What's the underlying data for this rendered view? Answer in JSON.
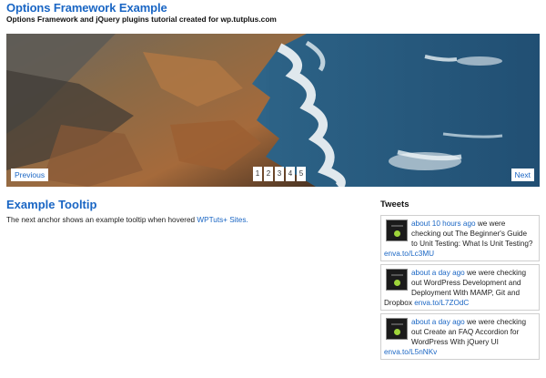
{
  "site": {
    "title": "Options Framework Example",
    "description": "Options Framework and jQuery plugins tutorial created for wp.tutplus.com"
  },
  "slider": {
    "prev_label": "Previous",
    "next_label": "Next",
    "pages": [
      "1",
      "2",
      "3",
      "4",
      "5"
    ]
  },
  "main": {
    "title": "Example Tooltip",
    "text": "The next anchor shows an example tooltip when hovered",
    "link": "WPTuts+ Sites."
  },
  "sidebar": {
    "title": "Tweets",
    "tweets": [
      {
        "time": "about 10 hours ago",
        "text": " we were checking out The Beginner's Guide to Unit Testing: What Is Unit Testing? ",
        "link": "enva.to/Lc3MU"
      },
      {
        "time": "about a day ago",
        "text": " we were checking out WordPress Development and Deployment With MAMP, Git and Dropbox ",
        "link": "enva.to/L7ZOdC"
      },
      {
        "time": "about a day ago",
        "text": " we were checking out Create an FAQ Accordion for WordPress With jQuery UI ",
        "link": "enva.to/L5nNKv"
      }
    ]
  },
  "colors": {
    "link_blue": "#1a66c4",
    "border": "#cfcfcf"
  }
}
